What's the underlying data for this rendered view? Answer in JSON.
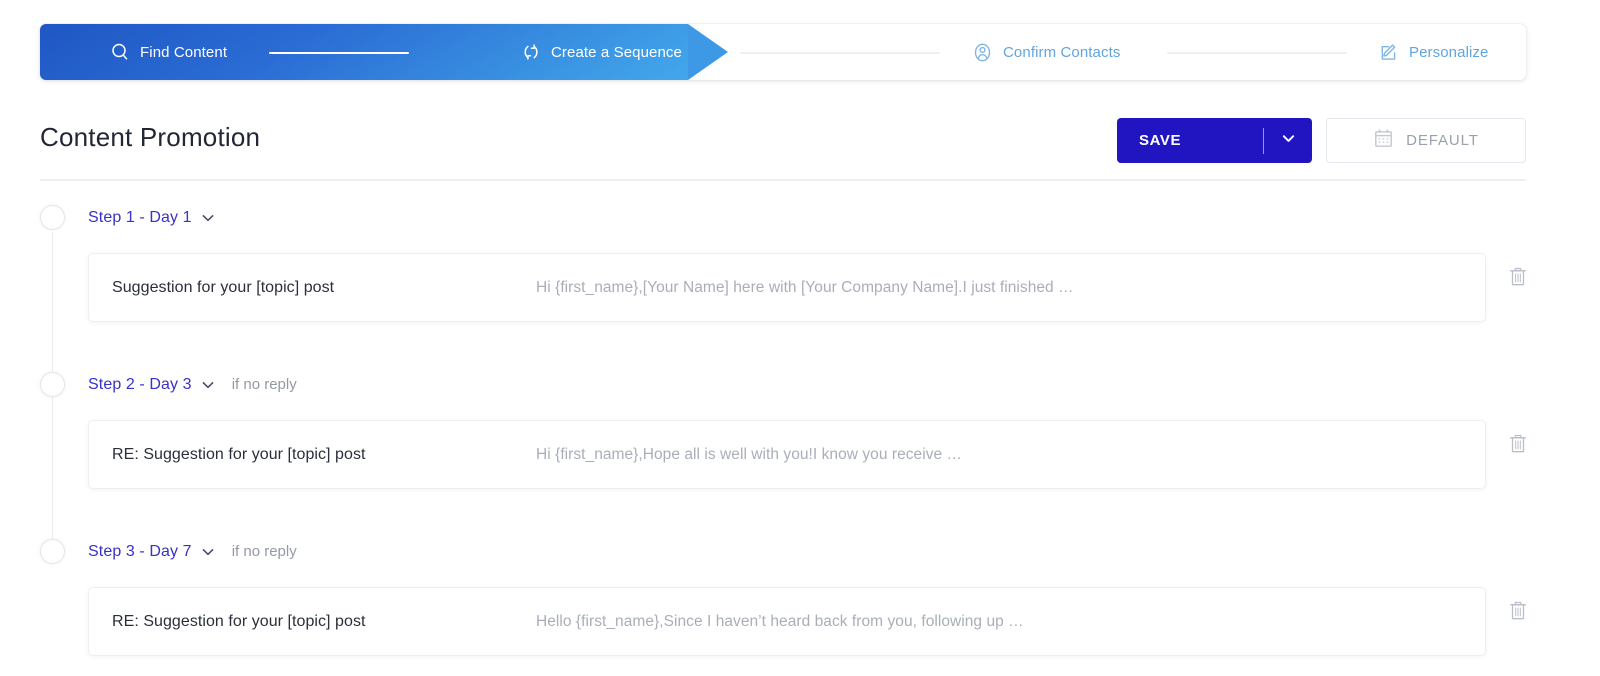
{
  "stepper": {
    "steps": [
      {
        "label": "Find Content",
        "icon": "search-icon",
        "state": "done"
      },
      {
        "label": "Create a Sequence",
        "icon": "refresh-icon",
        "state": "current"
      },
      {
        "label": "Confirm Contacts",
        "icon": "user-circle-icon",
        "state": "todo"
      },
      {
        "label": "Personalize",
        "icon": "edit-square-icon",
        "state": "todo"
      }
    ],
    "active_color": "#2a6bd4",
    "inactive_color": "#62a4e0"
  },
  "header": {
    "title": "Content Promotion",
    "save_label": "SAVE",
    "save_caret_icon": "chevron-down-icon",
    "default_label": "DEFAULT",
    "default_icon": "calendar-icon",
    "save_color": "#2015c0"
  },
  "sequence": {
    "steps": [
      {
        "heading": "Step 1 - Day 1",
        "condition": "",
        "caret_icon": "chevron-down-icon",
        "subject": "Suggestion for your [topic] post",
        "preview": "Hi {first_name},[Your Name] here with [Your Company Name].I just finished …",
        "delete_icon": "trash-icon"
      },
      {
        "heading": "Step 2 - Day 3",
        "condition": "if no reply",
        "caret_icon": "chevron-down-icon",
        "subject": "RE: Suggestion for your [topic] post",
        "preview": "Hi {first_name},Hope all is well with you!I know you receive …",
        "delete_icon": "trash-icon"
      },
      {
        "heading": "Step 3 - Day 7",
        "condition": "if no reply",
        "caret_icon": "chevron-down-icon",
        "subject": "RE: Suggestion for your [topic] post",
        "preview": "Hello {first_name},Since I haven’t heard back from you, following up …",
        "delete_icon": "trash-icon"
      }
    ],
    "step_color": "#3a32c8"
  }
}
